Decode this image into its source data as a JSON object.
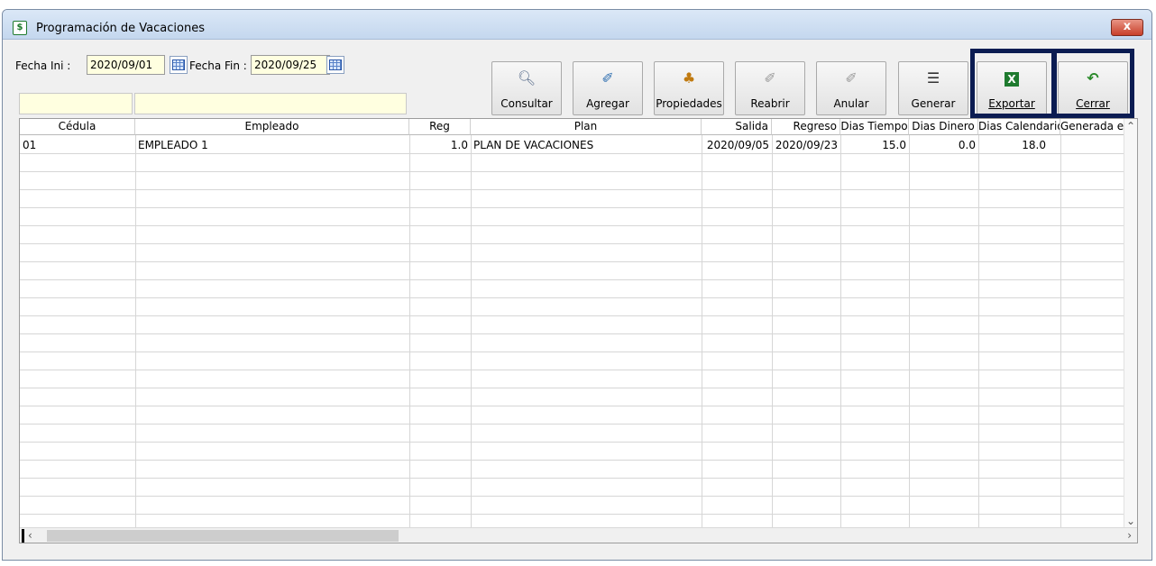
{
  "window": {
    "title": "Programación de Vacaciones",
    "close_label": "x"
  },
  "filters": {
    "fecha_ini_label": "Fecha Ini :",
    "fecha_ini_value": "2020/09/01",
    "fecha_fin_label": "Fecha Fin :",
    "fecha_fin_value": "2020/09/25"
  },
  "toolbar": {
    "consultar": "Consultar",
    "agregar": "Agregar",
    "propiedades": "Propiedades",
    "reabrir": "Reabrir",
    "anular": "Anular",
    "generar": "Generar",
    "exportar": "Exportar",
    "cerrar": "Cerrar"
  },
  "table": {
    "columns": [
      "Cédula",
      "Empleado",
      "Reg",
      "Plan",
      "Salida",
      "Regreso",
      "Dias Tiempo",
      "Dias Dinero",
      "Dias Calendario",
      "Generada en"
    ],
    "rows": [
      [
        "01",
        "EMPLEADO 1",
        "1.0",
        "PLAN DE VACACIONES",
        "2020/09/05",
        "2020/09/23",
        "15.0",
        "0.0",
        "18.0",
        ""
      ]
    ]
  },
  "icons": {
    "app": "spreadsheet-icon",
    "consultar": "magnifier-icon",
    "agregar": "add-document-icon",
    "propiedades": "shapes-icon",
    "reabrir": "reopen-icon",
    "anular": "void-icon",
    "generar": "document-icon",
    "exportar": "excel-icon",
    "cerrar": "undo-arrow-icon"
  },
  "colors": {
    "highlight": "#0b1c52",
    "input_bg": "#ffffe0",
    "excel_green": "#1e7a2e"
  }
}
